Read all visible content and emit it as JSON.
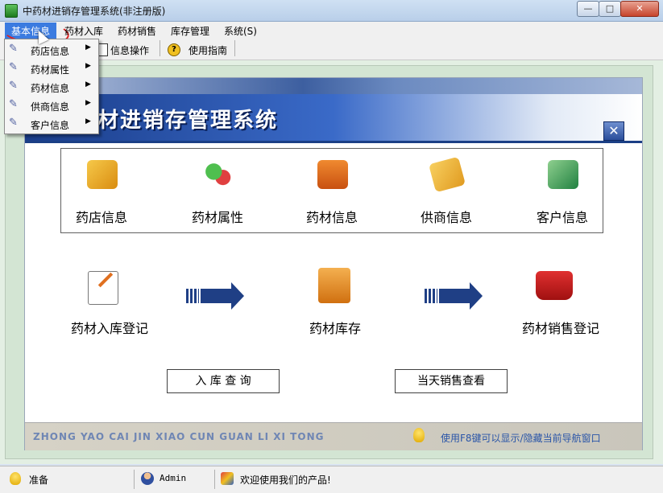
{
  "window": {
    "title": "中药材进销存管理系统(非注册版)",
    "controls": {
      "minimize": "—",
      "maximize": "□",
      "close": "✕"
    }
  },
  "menu": {
    "items": [
      {
        "label": "基本信息"
      },
      {
        "label": "药材入库"
      },
      {
        "label": "药材销售"
      },
      {
        "label": "库存管理"
      },
      {
        "label": "系统(S)"
      }
    ]
  },
  "toolbar": {
    "info_ops_label": "信息操作",
    "guide_label": "使用指南"
  },
  "dropdown": {
    "items": [
      {
        "label": "药店信息"
      },
      {
        "label": "药材属性"
      },
      {
        "label": "药材信息"
      },
      {
        "label": "供商信息"
      },
      {
        "label": "客户信息"
      }
    ]
  },
  "panel": {
    "title": "材进销存管理系统",
    "close_glyph": "✕",
    "info_items": [
      {
        "label": "药店信息",
        "color": "#e8a020"
      },
      {
        "label": "药材属性",
        "color": "#3aa040"
      },
      {
        "label": "药材信息",
        "color": "#e06a20"
      },
      {
        "label": "供商信息",
        "color": "#e8a020"
      },
      {
        "label": "客户信息",
        "color": "#30a050"
      }
    ],
    "flow": {
      "in_label": "药材入库登记",
      "stock_label": "药材库存",
      "sale_label": "药材销售登记"
    },
    "buttons": {
      "in_query": "入 库 查 询",
      "today_sales": "当天销售查看"
    },
    "footer_text": "ZHONG YAO CAI JIN XIAO CUN GUAN LI XI TONG",
    "footer_hint": "使用F8键可以显示/隐藏当前导航窗口"
  },
  "status": {
    "ready": "准备",
    "user": "Admin",
    "welcome": "欢迎使用我们的产品!"
  }
}
